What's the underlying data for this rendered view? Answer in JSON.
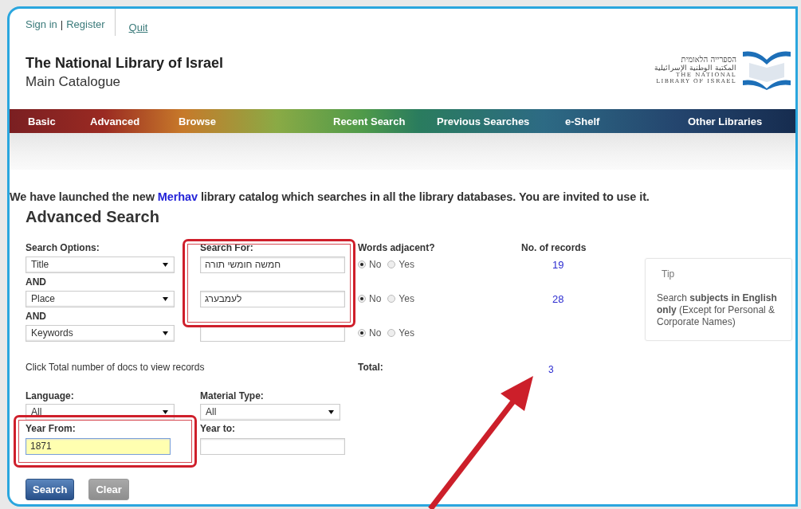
{
  "account": {
    "sign_in": "Sign in",
    "separator": "|",
    "register": "Register",
    "quit": "Quit"
  },
  "header": {
    "title": "The National Library of Israel",
    "subtitle": "Main Catalogue",
    "logo_lines": [
      "הספרייה הלאומית",
      "المكتبة الوطنية الإسرائيلية",
      "THE NATIONAL",
      "LIBRARY OF ISRAEL"
    ]
  },
  "nav": [
    {
      "label": "Basic"
    },
    {
      "label": "Advanced"
    },
    {
      "label": "Browse"
    },
    {
      "label": "Recent Search"
    },
    {
      "label": "Previous Searches"
    },
    {
      "label": "e-Shelf"
    },
    {
      "label": "Other Libraries"
    }
  ],
  "notice": {
    "before": "We have launched the new ",
    "link": "Merhav",
    "after": " library catalog which searches in all the library databases. You are invited to use it."
  },
  "form": {
    "heading": "Advanced Search",
    "columns": [
      "Search Options:",
      "Search For:",
      "Words adjacent?",
      "No. of records"
    ],
    "rows": [
      {
        "option": "Title",
        "value": "חמשה חומשי תורה",
        "radios": [
          {
            "label": "No",
            "selected": true
          },
          {
            "label": "Yes",
            "selected": false
          }
        ],
        "count": "19"
      },
      {
        "connector": "AND",
        "option": "Place",
        "value": "לעמבערג",
        "radios": [
          {
            "label": "No",
            "selected": true
          },
          {
            "label": "Yes",
            "selected": false
          }
        ],
        "count": "28"
      },
      {
        "connector": "AND",
        "option": "Keywords",
        "radios": [
          {
            "label": "No",
            "selected": true
          },
          {
            "label": "Yes",
            "selected": false
          }
        ]
      }
    ],
    "tip": {
      "title": "Tip",
      "text": "Search **subjects in English only** (Except for Personal & Corporate Names)"
    },
    "hint": "Click Total number of docs to view records",
    "total_label": "Total:",
    "total": "3",
    "language": {
      "label": "Language:",
      "value": "All"
    },
    "material": {
      "label": "Material Type:",
      "value": "All"
    },
    "year_from": {
      "label": "Year From:",
      "value": "1871",
      "focused": true
    },
    "year_to": {
      "label": "Year to:",
      "focused": false
    },
    "buttons": [
      {
        "label": "Search",
        "disabled": false
      },
      {
        "label": "Clear",
        "disabled": true
      }
    ]
  },
  "annotations": [
    {
      "kind": "highlight"
    },
    {
      "kind": "highlight"
    },
    {
      "kind": "arrow"
    }
  ]
}
